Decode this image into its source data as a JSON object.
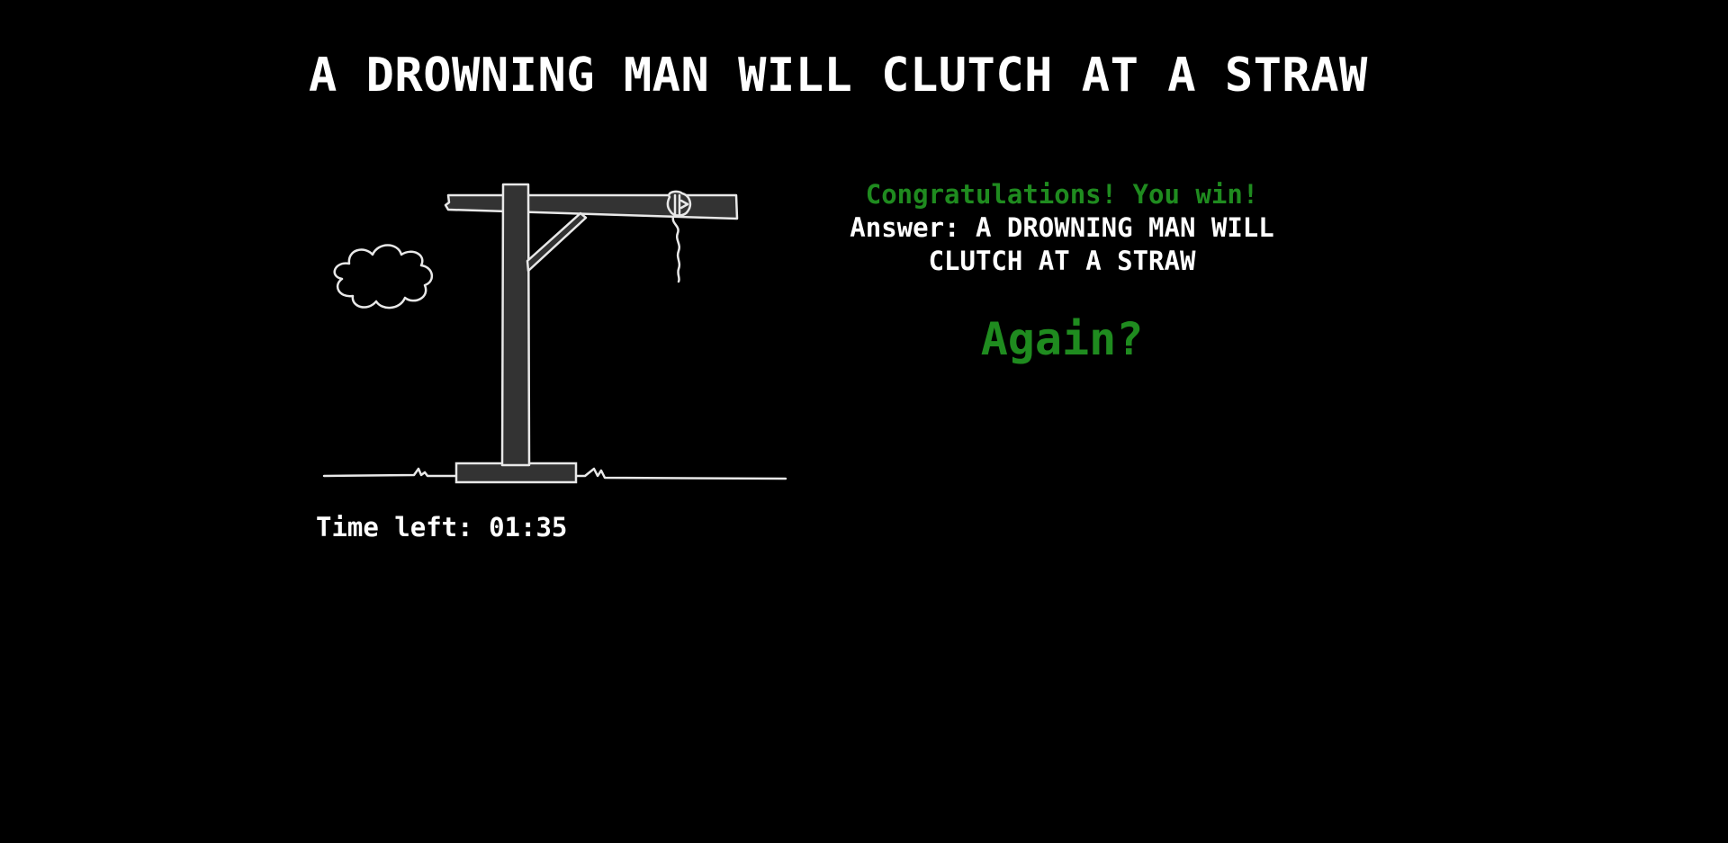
{
  "game": {
    "phrase": "A DROWNING MAN WILL CLUTCH AT A STRAW",
    "timer_label": "Time left:",
    "timer_value": "01:35",
    "result_message": "Congratulations! You win!",
    "answer_label": "Answer:",
    "answer_value": "A DROWNING MAN WILL CLUTCH AT A STRAW",
    "again_label": "Again?"
  },
  "colors": {
    "background": "#000000",
    "text": "#ffffff",
    "win": "#1f8b1f",
    "drawing_fill": "#333333",
    "drawing_stroke": "#e8e8e8"
  },
  "icons": {
    "gallows": "gallows-drawing",
    "cloud": "cloud-icon",
    "noose": "noose-icon"
  }
}
